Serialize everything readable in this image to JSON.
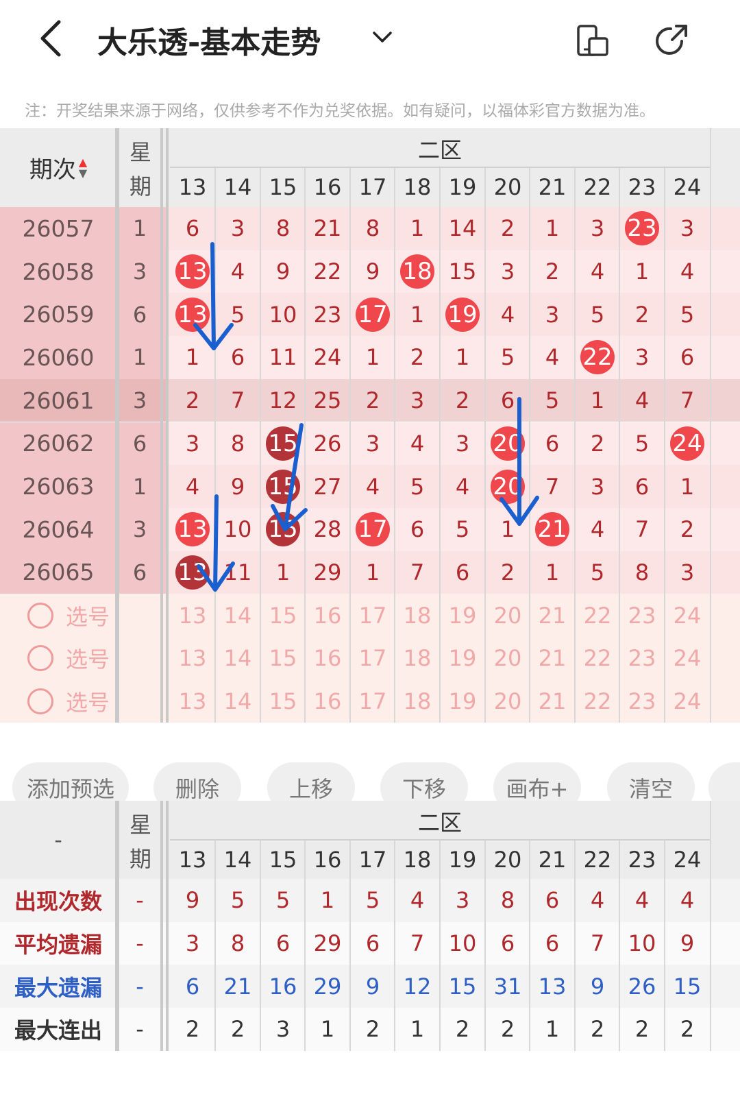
{
  "header": {
    "title": "大乐透-基本走势",
    "note": "注：开奖结果来源于网络，仅供参考不作为兑奖依据。如有疑问，以福体彩官方数据为准。"
  },
  "table": {
    "col_issue": "期次",
    "col_week": [
      "星",
      "期"
    ],
    "zone_label": "二区",
    "numbers": [
      "13",
      "14",
      "15",
      "16",
      "17",
      "18",
      "19",
      "20",
      "21",
      "22",
      "23",
      "24"
    ],
    "rows": [
      {
        "issue": "26057",
        "week": "1",
        "cells": [
          "6",
          "3",
          "8",
          "21",
          "8",
          "1",
          "14",
          "2",
          "1",
          "3",
          "23",
          "3"
        ]
      },
      {
        "issue": "26058",
        "week": "3",
        "cells": [
          "13",
          "4",
          "9",
          "22",
          "9",
          "18",
          "15",
          "3",
          "2",
          "4",
          "1",
          "4"
        ]
      },
      {
        "issue": "26059",
        "week": "6",
        "cells": [
          "13",
          "5",
          "10",
          "23",
          "17",
          "1",
          "19",
          "4",
          "3",
          "5",
          "2",
          "5"
        ]
      },
      {
        "issue": "26060",
        "week": "1",
        "cells": [
          "1",
          "6",
          "11",
          "24",
          "1",
          "2",
          "1",
          "5",
          "4",
          "22",
          "3",
          "6"
        ]
      },
      {
        "issue": "26061",
        "week": "3",
        "cells": [
          "2",
          "7",
          "12",
          "25",
          "2",
          "3",
          "2",
          "6",
          "5",
          "1",
          "4",
          "7"
        ]
      },
      {
        "issue": "26062",
        "week": "6",
        "cells": [
          "3",
          "8",
          "15",
          "26",
          "3",
          "4",
          "3",
          "20",
          "6",
          "2",
          "5",
          "24"
        ]
      },
      {
        "issue": "26063",
        "week": "1",
        "cells": [
          "4",
          "9",
          "15",
          "27",
          "4",
          "5",
          "4",
          "20",
          "7",
          "3",
          "6",
          "1"
        ]
      },
      {
        "issue": "26064",
        "week": "3",
        "cells": [
          "13",
          "10",
          "15",
          "28",
          "17",
          "6",
          "5",
          "1",
          "21",
          "4",
          "7",
          "2"
        ]
      },
      {
        "issue": "26065",
        "week": "6",
        "cells": [
          "13",
          "11",
          "1",
          "29",
          "1",
          "7",
          "6",
          "2",
          "1",
          "5",
          "8",
          "3"
        ]
      }
    ],
    "pick_label": "选号",
    "pick_rows": 3
  },
  "buttons": [
    "添加预选",
    "删除",
    "上移",
    "下移",
    "画布+",
    "清空"
  ],
  "stats": {
    "header_dash": "-",
    "col_week": [
      "星",
      "期"
    ],
    "zone_label": "二区",
    "numbers": [
      "13",
      "14",
      "15",
      "16",
      "17",
      "18",
      "19",
      "20",
      "21",
      "22",
      "23",
      "24"
    ],
    "rows": [
      {
        "label": "出现次数",
        "color": "#b0282b",
        "week": "-",
        "values": [
          "9",
          "5",
          "5",
          "1",
          "5",
          "4",
          "3",
          "8",
          "6",
          "4",
          "4",
          "4"
        ]
      },
      {
        "label": "平均遗漏",
        "color": "#b0282b",
        "week": "-",
        "values": [
          "3",
          "8",
          "6",
          "29",
          "6",
          "7",
          "10",
          "6",
          "6",
          "7",
          "10",
          "9"
        ]
      },
      {
        "label": "最大遗漏",
        "color": "#2e5fc4",
        "week": "-",
        "values": [
          "6",
          "21",
          "16",
          "29",
          "9",
          "12",
          "15",
          "31",
          "13",
          "9",
          "26",
          "15"
        ]
      },
      {
        "label": "最大连出",
        "color": "#333333",
        "week": "-",
        "values": [
          "2",
          "2",
          "3",
          "1",
          "2",
          "1",
          "2",
          "2",
          "1",
          "2",
          "2",
          "2"
        ]
      }
    ]
  },
  "colors": {
    "ball_red": "#f0474c",
    "ball_dark": "#b23438",
    "arrow_blue": "#1a5fd0"
  },
  "icons": [
    "back-arrow-icon",
    "chevron-down-icon",
    "rotate-screen-icon",
    "share-icon"
  ]
}
